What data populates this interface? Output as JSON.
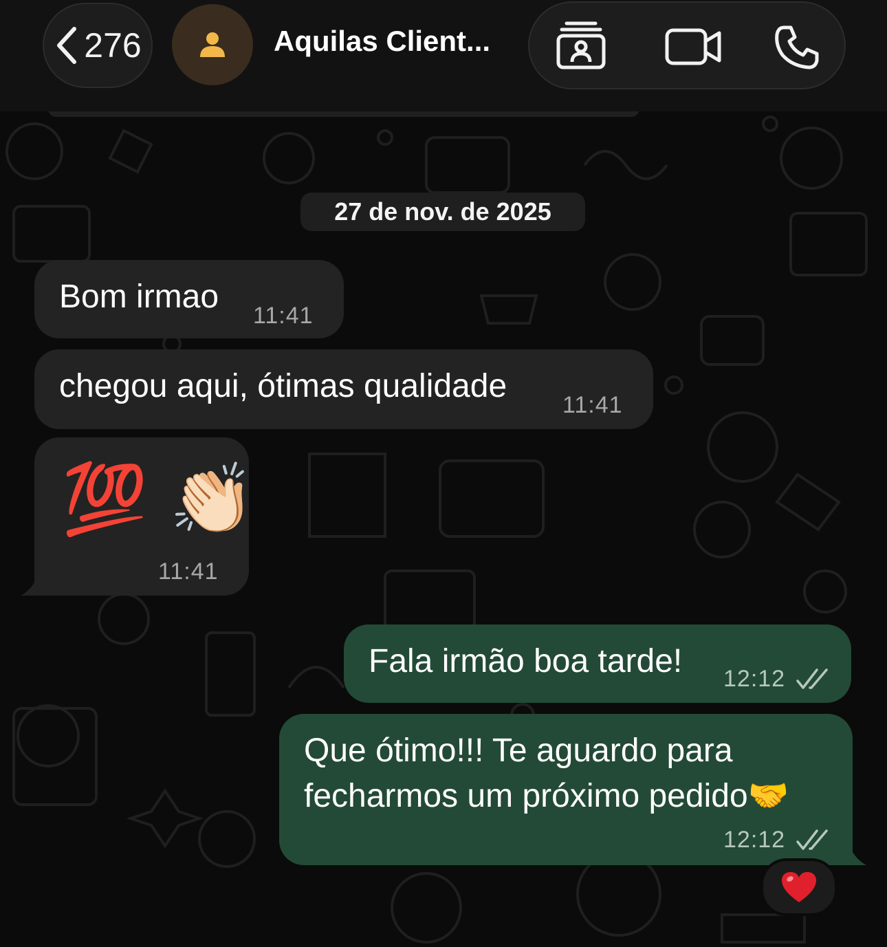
{
  "header": {
    "unread_count": "276",
    "contact_name": "Aquilas Client...",
    "icons": [
      "chevron-left-icon",
      "person-icon",
      "contact-card-icon",
      "video-camera-icon",
      "phone-icon"
    ]
  },
  "chat": {
    "date_separator": "27 de nov. de 2025",
    "messages": [
      {
        "direction": "in",
        "text": "Bom irmao",
        "time": "11:41"
      },
      {
        "direction": "in",
        "text": "chegou aqui, ótimas qualidade",
        "time": "11:41"
      },
      {
        "direction": "in",
        "text": "💯 👏🏻",
        "time": "11:41"
      },
      {
        "direction": "out",
        "text": "Fala irmão boa tarde!",
        "time": "12:12",
        "status": "read"
      },
      {
        "direction": "out",
        "lines": [
          "Que ótimo!!! Te aguardo para",
          "fecharmos um próximo pedido🤝"
        ],
        "time": "12:12",
        "status": "read",
        "reaction": "❤️"
      }
    ]
  },
  "colors": {
    "incoming_bubble": "#232323",
    "outgoing_bubble": "#234a36",
    "background": "#0b0b0b",
    "header": "#121212"
  }
}
